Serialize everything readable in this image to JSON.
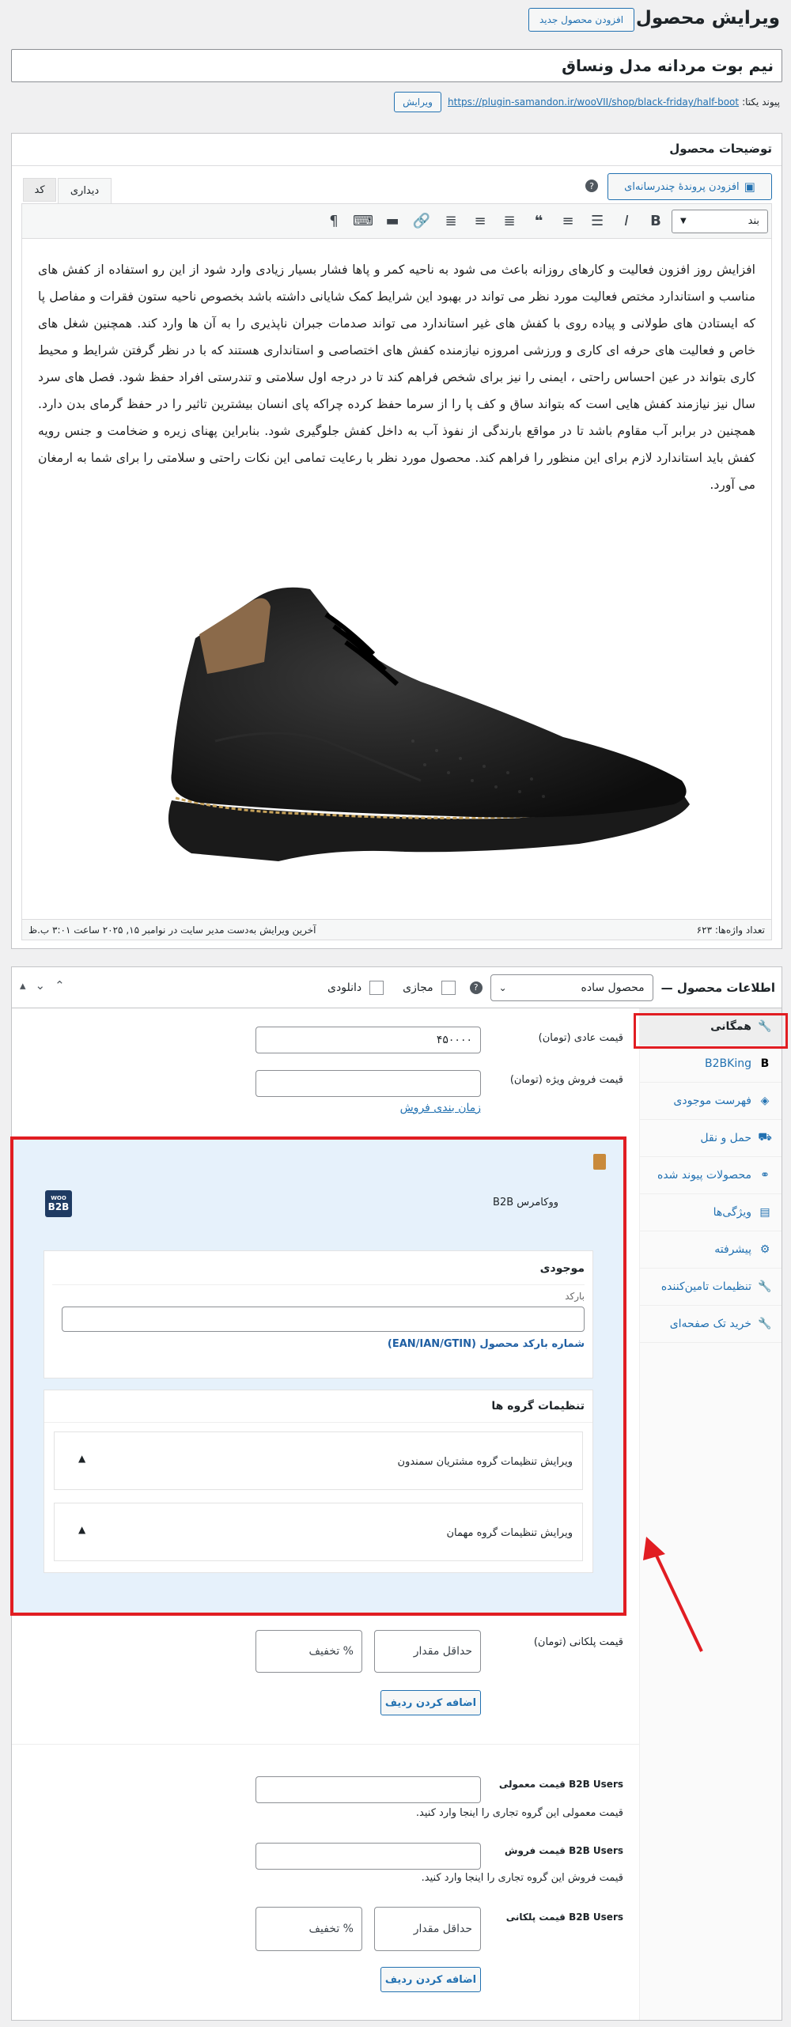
{
  "header": {
    "title": "ویرایش محصول",
    "add_new_label": "افزودن محصول جدید"
  },
  "product": {
    "title_value": "نیم بوت مردانه مدل ونساق",
    "permalink_label": "پیوند یکتا:",
    "permalink_url": "https://plugin-samandon.ir/wooVII/shop/black-friday/half-boot",
    "permalink_edit": "ویرایش"
  },
  "description": {
    "heading": "توضیحات محصول",
    "add_media": "افزودن پروندهٔ چندرسانه‌ای",
    "tab_visual": "دیداری",
    "tab_code": "کد",
    "format_select": "بند",
    "body_text": "افزایش روز افزون فعالیت و کارهای روزانه باعث می شود به ناحیه کمر و پاها فشار بسیار زیادی وارد شود از این رو استفاده از کفش های مناسب و استاندارد مختص فعالیت مورد نظر می تواند در بهبود این شرایط کمک شایانی داشته باشد بخصوص ناحیه ستون فقرات و مفاصل پا که ایستادن های طولانی و پیاده روی با کفش های غیر استاندارد می تواند صدمات جبران ناپذیری را به آن ها وارد کند. همچنین شغل های خاص و فعالیت های حرفه ای کاری و ورزشی امروزه نیازمنده کفش های اختصاصی و استانداری هستند که با در نظر گرفتن شرایط و محیط کاری بتواند در عین احساس راحتی ، ایمنی را نیز برای شخص فراهم کند تا در درجه اول سلامتی و تندرستی افراد حفظ شود. فصل های سرد سال نیز نیازمند کفش هایی است که بتواند ساق و کف پا را از سرما حفظ کرده چراکه پای انسان بیشترین تاثیر را در حفظ گرمای بدن دارد. همچنین در برابر آب مقاوم باشد تا در مواقع بارندگی از نفوذ آب به داخل کفش جلوگیری شود. بنابراین پهنای زیره و ضخامت و جنس رویه کفش باید استاندارد لازم برای این منظور را فراهم کند. محصول مورد نظر با رعایت تمامی این نکات راحتی و سلامتی را برای شما به ارمغان می آورد.",
    "word_count": "تعداد واژه‌ها: ۶۲۳",
    "last_edit": "آخرین ویرایش به‌دست مدیر سایت در نوامبر ۱۵, ۲۰۲۵ ساعت ۳:۰۱ ب.ظ"
  },
  "product_data": {
    "heading": "اطلاعات محصول —",
    "type_select": "محصول ساده",
    "virtual_label": "مجازی",
    "downloadable_label": "دانلودی",
    "tabs": [
      {
        "label": "همگانی",
        "icon": "wrench-icon"
      },
      {
        "label": "B2BKing",
        "icon": "b2bking-icon"
      },
      {
        "label": "فهرست موجودی",
        "icon": "tag-icon"
      },
      {
        "label": "حمل و نقل",
        "icon": "truck-icon"
      },
      {
        "label": "محصولات پیوند شده",
        "icon": "link-icon"
      },
      {
        "label": "ویژگی‌ها",
        "icon": "list-icon"
      },
      {
        "label": "پیشرفته",
        "icon": "gear-icon"
      },
      {
        "label": "تنظیمات تامین‌کننده",
        "icon": "wrench-icon"
      },
      {
        "label": "خرید تک صفحه‌ای",
        "icon": "wrench-icon"
      }
    ],
    "regular_price_label": "قیمت عادی (تومان)",
    "regular_price_value": "۴۵۰۰۰۰",
    "sale_price_label": "قیمت فروش ویژه (تومان)",
    "schedule_link": "زمان بندی فروش"
  },
  "b2b_box": {
    "title": "ووکامرس B2B",
    "logo_top": "WOO",
    "logo_text": "B2B",
    "inventory_heading": "موجودی",
    "barcode_label": "بارکد",
    "barcode_help": "شماره بارکد محصول (EAN/IAN/GTIN)",
    "groups_heading": "تنظیمات گروه ها",
    "group1": "ویرایش تنظیمات گروه مشتریان سمندون",
    "group2": "ویرایش تنظیمات گروه مهمان"
  },
  "tiered": {
    "label": "قیمت پلکانی (تومان)",
    "min_qty_placeholder": "حداقل مقدار",
    "discount_placeholder": "% تخفیف",
    "add_row": "اضافه کردن ردیف"
  },
  "b2b_users": {
    "regular_label": "B2B Users قیمت معمولی",
    "regular_help": "قیمت معمولی این گروه تجاری را اینجا وارد کنید.",
    "sale_label": "B2B Users قیمت فروش",
    "sale_help": "قیمت فروش این گروه تجاری را اینجا وارد کنید.",
    "tiered_label": "B2B Users قیمت پلکانی",
    "min_qty_placeholder": "حداقل مقدار",
    "discount_placeholder": "% تخفیف",
    "add_row": "اضافه کردن ردیف"
  },
  "colors": {
    "accent": "#2271b1",
    "highlight_red": "#e11d22",
    "b2b_bg": "#e6f1fb"
  }
}
